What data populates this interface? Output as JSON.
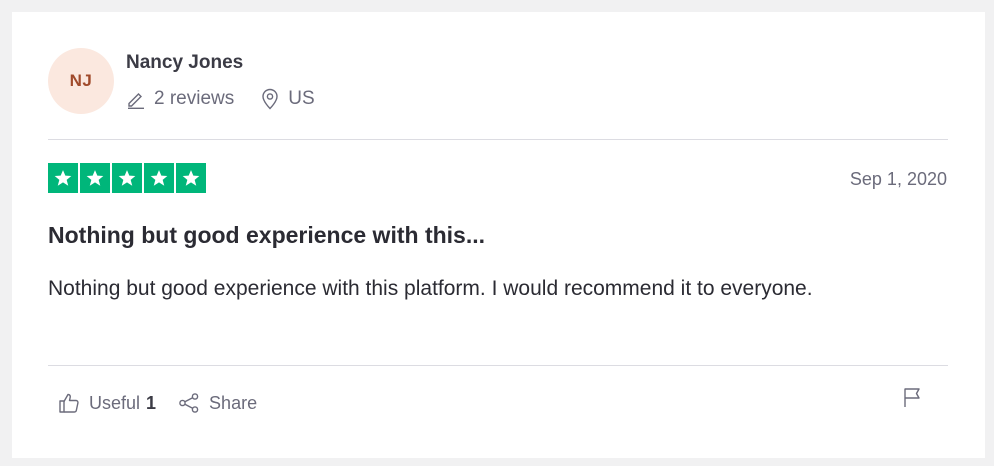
{
  "consumer": {
    "initials": "NJ",
    "name": "Nancy Jones",
    "reviews_label": "2 reviews",
    "country": "US"
  },
  "review": {
    "rating": 5,
    "max_rating": 5,
    "date": "Sep 1, 2020",
    "title": "Nothing but good experience with this...",
    "body": "Nothing but good experience with this platform. I would recommend it to everyone."
  },
  "actions": {
    "useful_label": "Useful",
    "useful_count": "1",
    "share_label": "Share"
  },
  "colors": {
    "star_green": "#00b67a",
    "avatar_bg": "#fbe8df",
    "avatar_text": "#a04a2b"
  },
  "icons": [
    "pencil-icon",
    "location-pin-icon",
    "star-icon",
    "thumbs-up-icon",
    "share-icon",
    "flag-icon"
  ]
}
